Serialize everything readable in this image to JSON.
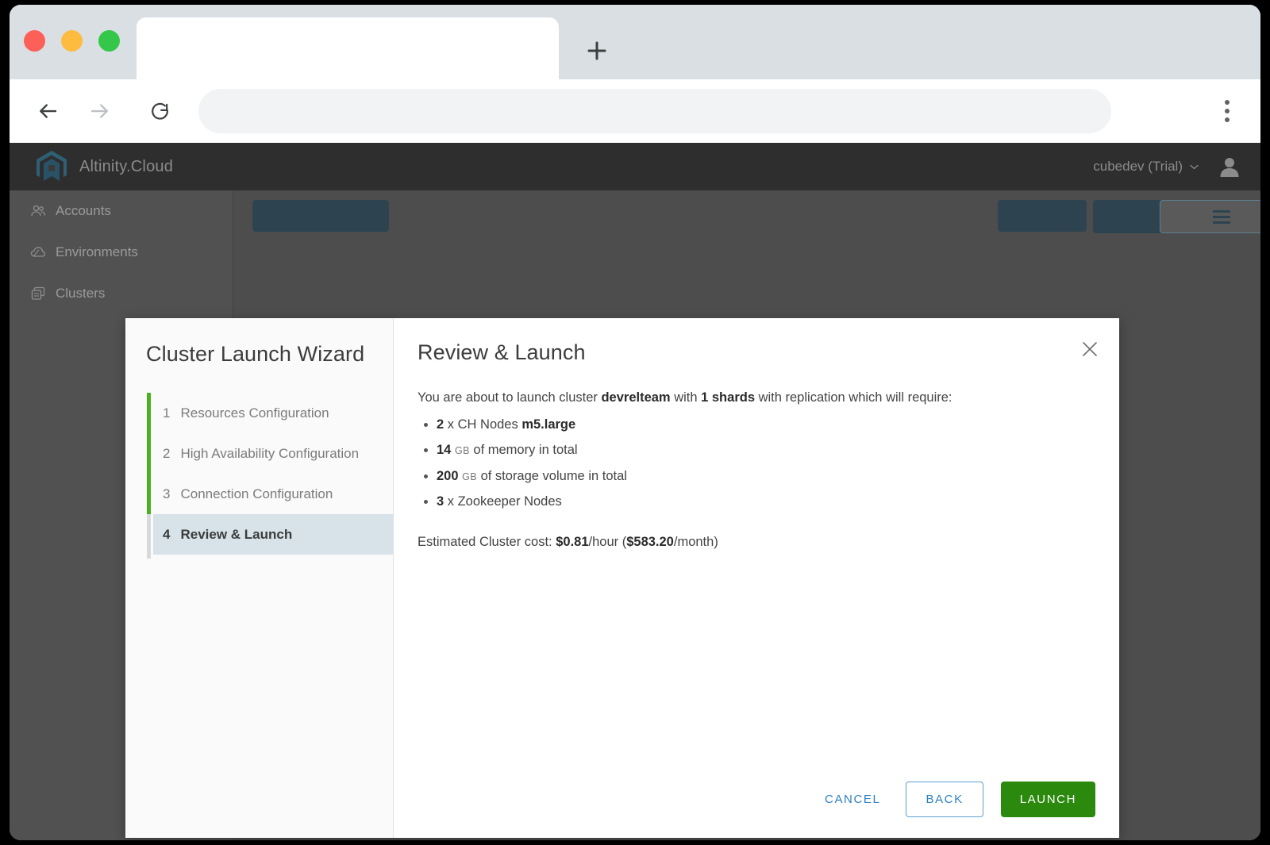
{
  "browser": {
    "tab_title": "",
    "url_value": "",
    "url_placeholder": "",
    "back_icon": "arrow-left-icon",
    "forward_icon": "arrow-right-icon",
    "reload_icon": "reload-icon",
    "new_tab_icon": "plus-icon",
    "menu_icon": "kebab-menu-icon",
    "traffic_lights": [
      "close-red",
      "minimize-yellow",
      "maximize-green"
    ]
  },
  "app": {
    "brand_name": "Altinity.Cloud",
    "brand_logo_icon": "altinity-logo-icon",
    "account_label": "cubedev (Trial)",
    "account_chevron_icon": "chevron-down-icon",
    "avatar_icon": "user-avatar-icon",
    "navbar_color": "#2e2e2e",
    "overlay_color": "#4d4d4d"
  },
  "sidebar": {
    "items": [
      {
        "label": "Accounts",
        "icon": "people-icon"
      },
      {
        "label": "Environments",
        "icon": "cloud-icon"
      },
      {
        "label": "Clusters",
        "icon": "stacked-boxes-icon"
      }
    ]
  },
  "modal": {
    "wizard_title": "Cluster Launch Wizard",
    "panel_title": "Review & Launch",
    "close_icon": "close-icon",
    "rail_complete_color": "#4caf1e",
    "rail_pending_color": "#d9d9d9",
    "active_step_bg": "#d7e3e9",
    "steps": [
      {
        "num": "1",
        "label": "Resources Configuration",
        "state": "complete"
      },
      {
        "num": "2",
        "label": "High Availability Configuration",
        "state": "complete"
      },
      {
        "num": "3",
        "label": "Connection Configuration",
        "state": "complete"
      },
      {
        "num": "4",
        "label": "Review & Launch",
        "state": "active"
      }
    ],
    "summary": {
      "lead_1": "You are about to launch cluster ",
      "cluster_name": "devrelteam",
      "lead_2": " with ",
      "shards": "1 shards",
      "lead_3": " with replication which will require:",
      "requirements": [
        {
          "value": "2",
          "unit": "",
          "text_before": " x CH Nodes ",
          "emphasis": "m5.large",
          "text_after": ""
        },
        {
          "value": "14",
          "unit": "GB",
          "text_before": " of memory in total",
          "emphasis": "",
          "text_after": ""
        },
        {
          "value": "200",
          "unit": "GB",
          "text_before": " of storage volume in total",
          "emphasis": "",
          "text_after": ""
        },
        {
          "value": "3",
          "unit": "",
          "text_before": " x Zookeeper Nodes",
          "emphasis": "",
          "text_after": ""
        }
      ],
      "cost_label": "Estimated Cluster cost: ",
      "cost_hourly": "$0.81",
      "cost_hourly_suffix": "/hour (",
      "cost_monthly": "$583.20",
      "cost_monthly_suffix": "/month)"
    },
    "buttons": {
      "cancel": "CANCEL",
      "back": "BACK",
      "launch": "LAUNCH",
      "launch_color": "#2b8a0d",
      "link_color": "#2d7fc1"
    }
  }
}
